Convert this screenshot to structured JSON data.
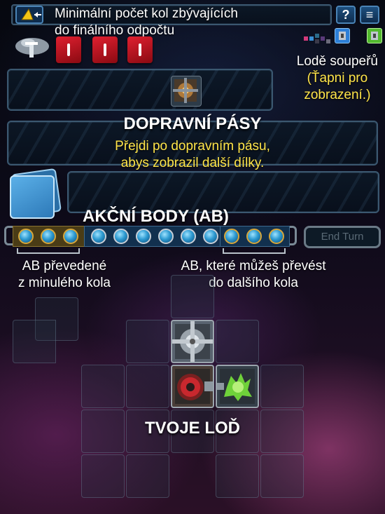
{
  "header": {
    "rounds_hint_line1": "Minimální počet kol zbývajících",
    "rounds_hint_line2": "do finálního odpočtu",
    "help_label": "?",
    "menu_label": "≡"
  },
  "opponents": {
    "hint_line1": "Lodě soupeřů",
    "hint_line2": "(Ťapni pro",
    "hint_line3": "zobrazení.)",
    "badge_colors": [
      "#2c7fd8",
      "#52b92e"
    ]
  },
  "conveyor": {
    "title": "DOPRAVNÍ PÁSY",
    "hint_line1": "Přejdi po dopravním pásu,",
    "hint_line2": "abys zobrazil další dílky."
  },
  "action_points": {
    "title": "AKČNÍ BODY (AB)",
    "previous_count": 3,
    "current_count": 6,
    "carry_count": 3,
    "end_turn_label": "End Turn",
    "previous_caption_line1": "AB převedené",
    "previous_caption_line2": "z minulého kola",
    "carry_caption_line1": "AB, které můžeš převést",
    "carry_caption_line2": "do dalšího kola"
  },
  "ship": {
    "label": "TVOJE LOĎ"
  },
  "colors": {
    "hint_yellow": "#ffe54a",
    "token_red": "#e02030",
    "panel_border": "#3b5870",
    "card_blue": "#3f8fcf"
  }
}
